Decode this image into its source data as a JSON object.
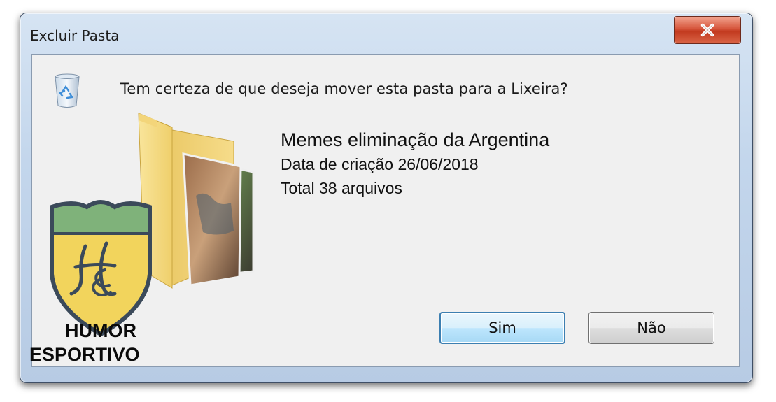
{
  "window": {
    "title": "Excluir Pasta",
    "close_label": "x"
  },
  "dialog": {
    "question": "Tem certeza de que deseja mover esta pasta para a Lixeira?",
    "folder": {
      "name": "Memes eliminação da Argentina",
      "created": "Data de criação 26/06/2018",
      "total": "Total 38 arquivos"
    },
    "buttons": {
      "yes": "Sim",
      "no": "Não"
    }
  },
  "watermark": {
    "monogram": "HE",
    "line1": "HUMOR",
    "line2": "ESPORTIVO",
    "shield_top_color": "#7fb27a",
    "shield_body_color": "#f2d45c"
  },
  "icons": {
    "recycle_bin": "recycle-bin-icon",
    "folder": "folder-icon",
    "close": "close-icon"
  }
}
